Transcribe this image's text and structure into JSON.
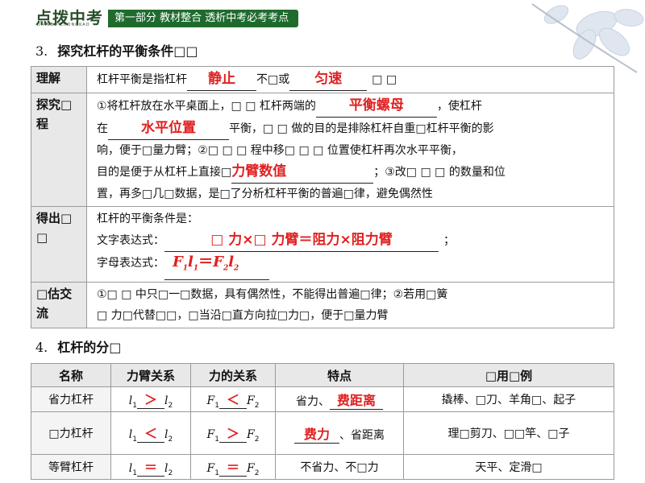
{
  "header": {
    "logo": "点拨中考",
    "logo_sub": "DIANBO ZHONGKAO",
    "banner": "第一部分  教材整合    透析中考必考考点"
  },
  "section3": {
    "num": "3.",
    "title": "探究杠杆的平衡条件□□",
    "rows": {
      "understand": {
        "label": "理解",
        "t1": "杠杆平衡是指杠杆",
        "a1": "静止",
        "t2": "不□或",
        "a2": "匀速",
        "t3": "□ □"
      },
      "explore": {
        "label": "探究□程",
        "t1": "①将杠杆放在水平桌面上，□ □ 杠杆两端的",
        "a1": "平衡螺母",
        "t2": "，使杠杆",
        "t3": "在",
        "a2": "水平位置",
        "t4": "平衡，□ □ 做的目的是排除杠杆自重□杠杆平衡的影",
        "t5": "响，便于□量力臂；②□ □ □ 程中移□ □ □ 位置使杠杆再次水平平衡，",
        "t6": "目的是便于从杠杆上直接□",
        "a3": "力臂数值",
        "t7": "；③改□ □ □ 的数量和位",
        "t8": "置，再多□几□数据，是□了分析杠杆平衡的普遍□律，避免偶然性"
      },
      "conclusion": {
        "label": "得出□ □",
        "t1": "杠杆的平衡条件是：",
        "t2": "文字表达式：",
        "a1": "□ 力×□ 力臂＝阻力×阻力臂",
        "t3": "；",
        "t4": "字母表达式：",
        "a2_f1": "F",
        "a2_s1": "1",
        "a2_l1": "l",
        "a2_s2": "1",
        "a2_eq": "＝",
        "a2_f2": "F",
        "a2_s3": "2",
        "a2_l2": "l",
        "a2_s4": "2"
      },
      "evaluate": {
        "label": "□估交流",
        "t1": "①□ □ 中只□一□数据，具有偶然性，不能得出普遍□律；②若用□簧",
        "t2": "□ 力□代替□□，□当沿□直方向拉□力□，便于□量力臂"
      }
    }
  },
  "section4": {
    "num": "4.",
    "title": "杠杆的分□",
    "headers": [
      "名称",
      "力臂关系",
      "力的关系",
      "特点",
      "□用□例"
    ],
    "rows": [
      {
        "name": "省力杠杆",
        "arm_rel": "＞",
        "force_rel": "＜",
        "feat_pre": "省力、",
        "feat_ans": "费距离",
        "feat_post": "",
        "examples": "撬棒、□刀、羊角□、起子"
      },
      {
        "name": "□力杠杆",
        "arm_rel": "＜",
        "force_rel": "＞",
        "feat_pre": "",
        "feat_ans": "费力",
        "feat_post": "、省距离",
        "examples": "理□剪刀、□□竿、□子"
      },
      {
        "name": "等臂杠杆",
        "arm_rel": "＝",
        "force_rel": "＝",
        "feat_pre": "不省力、不□力",
        "feat_ans": "",
        "feat_post": "",
        "examples": "天平、定滑□"
      }
    ],
    "sym": {
      "l": "l",
      "F": "F",
      "s1": "1",
      "s2": "2"
    }
  },
  "colors": {
    "answer": "#e02020",
    "banner": "#1f6b2e",
    "label_bg": "#e8e8e8",
    "border": "#9a9a9a"
  }
}
